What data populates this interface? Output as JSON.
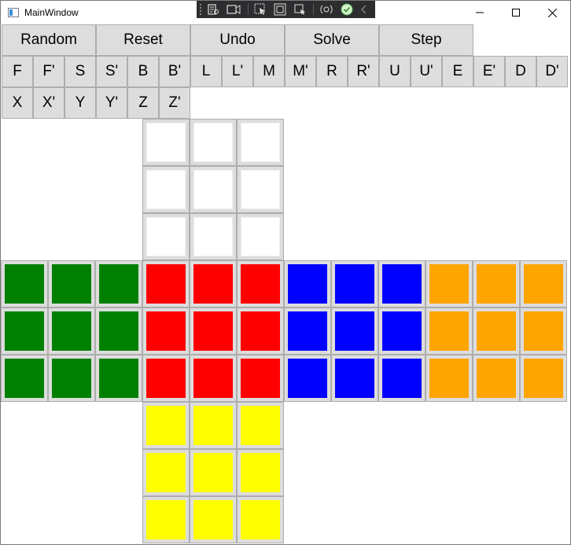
{
  "window": {
    "title": "MainWindow"
  },
  "colors": {
    "white": "#ffffff",
    "green": "#008000",
    "red": "#ff0000",
    "blue": "#0000ff",
    "orange": "#ffa500",
    "yellow": "#ffff00"
  },
  "toolbar": {
    "commands": [
      "Random",
      "Reset",
      "Undo",
      "Solve",
      "Step"
    ],
    "moves_row1": [
      "F",
      "F'",
      "S",
      "S'",
      "B",
      "B'",
      "L",
      "L'",
      "M",
      "M'",
      "R",
      "R'",
      "U",
      "U'",
      "E",
      "E'",
      "D",
      "D'"
    ],
    "moves_row2": [
      "X",
      "X'",
      "Y",
      "Y'",
      "Z",
      "Z'"
    ]
  },
  "cube": {
    "faces": [
      {
        "name": "up",
        "color": "white"
      },
      {
        "name": "left",
        "color": "green"
      },
      {
        "name": "front",
        "color": "red"
      },
      {
        "name": "right",
        "color": "blue"
      },
      {
        "name": "back",
        "color": "orange"
      },
      {
        "name": "down",
        "color": "yellow"
      }
    ]
  }
}
